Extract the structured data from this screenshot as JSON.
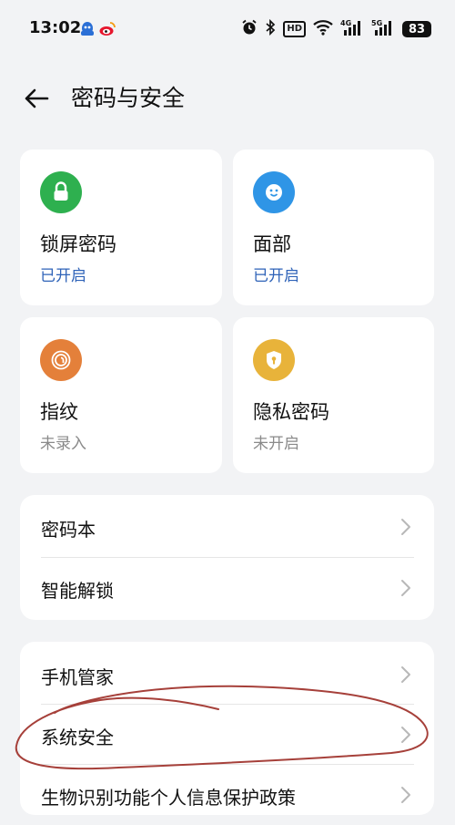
{
  "status_bar": {
    "time": "13:02",
    "battery": "83",
    "hd": "HD"
  },
  "header": {
    "title": "密码与安全"
  },
  "cards": [
    {
      "title": "锁屏密码",
      "status": "已开启",
      "icon": "lock-icon",
      "color": "#2eb04f"
    },
    {
      "title": "面部",
      "status": "已开启",
      "icon": "face-icon",
      "color": "#2f95e6"
    },
    {
      "title": "指纹",
      "status": "未录入",
      "icon": "fingerprint-icon",
      "color": "#e4803a"
    },
    {
      "title": "隐私密码",
      "status": "未开启",
      "icon": "privacy-shield-icon",
      "color": "#e8b33a"
    }
  ],
  "group1": [
    {
      "label": "密码本"
    },
    {
      "label": "智能解锁"
    }
  ],
  "group2": [
    {
      "label": "手机管家"
    },
    {
      "label": "系统安全"
    },
    {
      "label": "生物识别功能个人信息保护政策"
    }
  ],
  "colors": {
    "accent_on": "#2f63b8",
    "annotation": "#a6403a"
  }
}
